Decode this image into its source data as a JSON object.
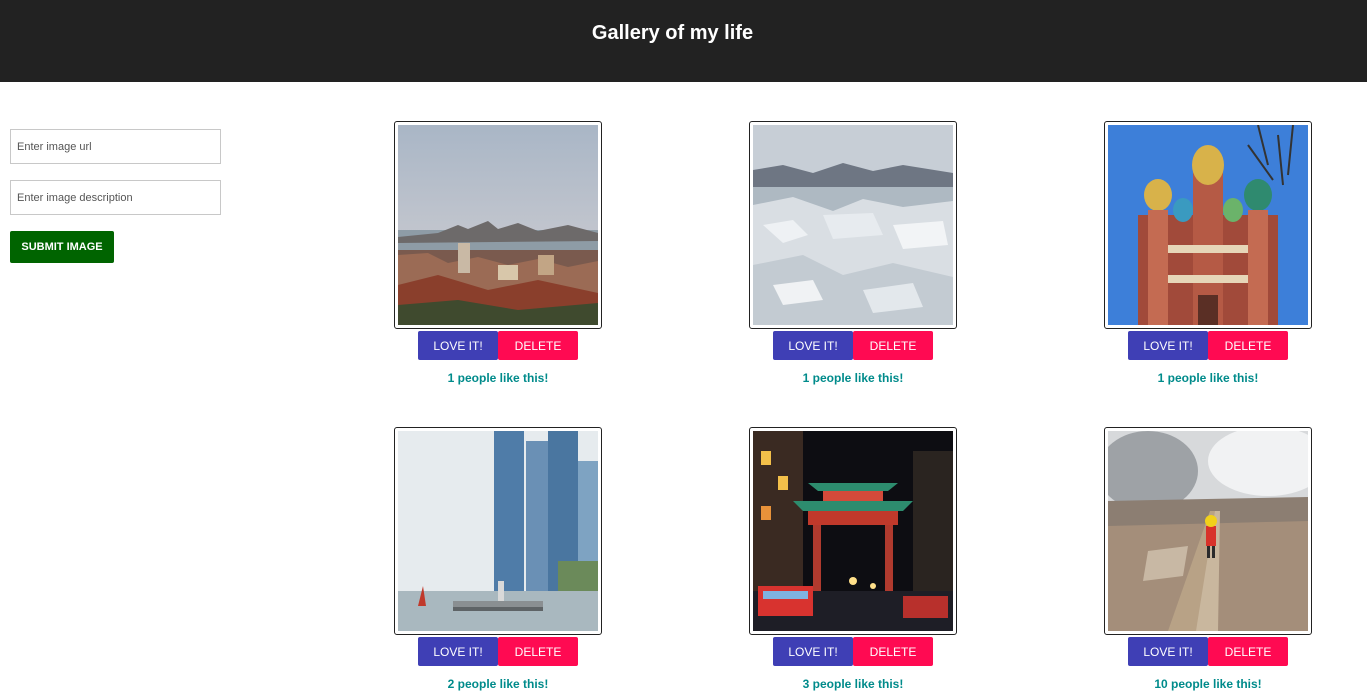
{
  "header": {
    "title": "Gallery of my life"
  },
  "form": {
    "url_placeholder": "Enter image url",
    "description_placeholder": "Enter image description",
    "submit_label": "SUBMIT IMAGE"
  },
  "colors": {
    "header_bg": "#222222",
    "submit_bg": "#006400",
    "love_bg": "#3f3fb5",
    "delete_bg": "#ff0a52",
    "likes_text": "#008b8b"
  },
  "gallery": [
    {
      "scene": "city-river-icon",
      "love_label": "LOVE IT!",
      "delete_label": "DELETE",
      "likes_text": "1 people like this!"
    },
    {
      "scene": "glacier-lagoon-icon",
      "love_label": "LOVE IT!",
      "delete_label": "DELETE",
      "likes_text": "1 people like this!"
    },
    {
      "scene": "onion-dome-church-icon",
      "love_label": "LOVE IT!",
      "delete_label": "DELETE",
      "likes_text": "1 people like this!"
    },
    {
      "scene": "skyline-waterfront-icon",
      "love_label": "LOVE IT!",
      "delete_label": "DELETE",
      "likes_text": "2 people like this!"
    },
    {
      "scene": "chinatown-gate-night-icon",
      "love_label": "LOVE IT!",
      "delete_label": "DELETE",
      "likes_text": "3 people like this!"
    },
    {
      "scene": "boardwalk-steam-icon",
      "love_label": "LOVE IT!",
      "delete_label": "DELETE",
      "likes_text": "10 people like this!"
    }
  ]
}
